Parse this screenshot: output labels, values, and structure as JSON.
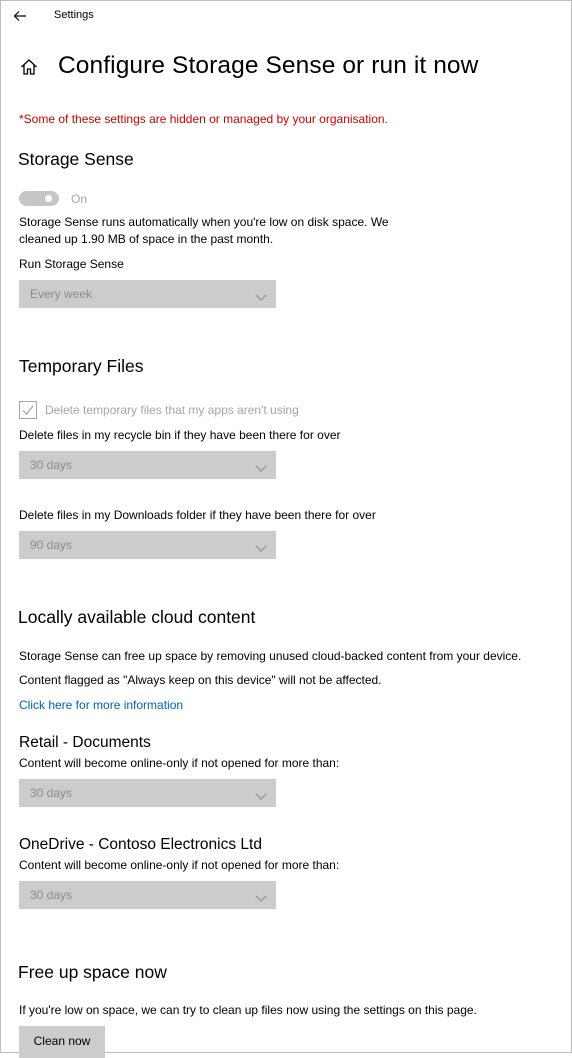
{
  "window": {
    "title": "Settings"
  },
  "page": {
    "title": "Configure Storage Sense or run it now",
    "managed_notice": "*Some of these settings are hidden or managed by your organisation."
  },
  "storage_sense": {
    "heading": "Storage Sense",
    "toggle_label": "On",
    "toggle_on": true,
    "description_line1": "Storage Sense runs automatically when you're low on disk space. We",
    "description_line2": "cleaned up 1.90 MB of space in the past month.",
    "run_label": "Run Storage Sense",
    "run_value": "Every week"
  },
  "temporary_files": {
    "heading": "Temporary Files",
    "checkbox_label": "Delete temporary files that my apps aren't using",
    "checkbox_checked": true,
    "recycle_label": "Delete files in my recycle bin if they have been there for over",
    "recycle_value": "30 days",
    "downloads_label": "Delete files in my Downloads folder if they have been there for over",
    "downloads_value": "90 days"
  },
  "cloud": {
    "heading": "Locally available cloud content",
    "description_line1": "Storage Sense can free up space by removing unused cloud-backed content from your device.",
    "description_line2": "Content flagged as \"Always keep on this device\" will not be affected.",
    "link": "Click here for more information",
    "accounts": [
      {
        "name": "Retail - Documents",
        "label": "Content will become online-only if not opened for more than:",
        "value": "30 days"
      },
      {
        "name": "OneDrive - Contoso Electronics Ltd",
        "label": "Content will become online-only if not opened for more than:",
        "value": "30 days"
      }
    ]
  },
  "free_up": {
    "heading": "Free up space now",
    "description": "If you're low on space, we can try to clean up files now using the settings on this page.",
    "button": "Clean now"
  },
  "colors": {
    "notice": "#d00000",
    "link": "#0063b1",
    "disabled_control": "#cccccc",
    "disabled_text": "#a6a6a6"
  },
  "icons": [
    "back-arrow-icon",
    "home-icon",
    "chevron-down-icon",
    "checkmark-icon"
  ]
}
